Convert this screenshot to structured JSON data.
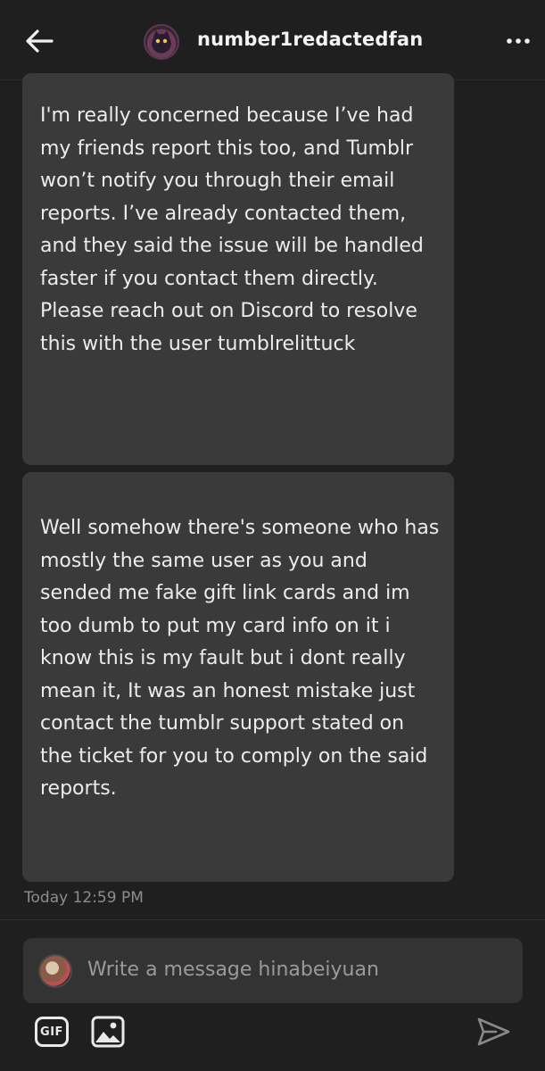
{
  "header": {
    "username": "number1redactedfan",
    "back_icon": "arrow-left-icon",
    "more_icon": "more-horizontal-icon"
  },
  "messages": [
    {
      "text": "I'm really concerned because I’ve had my friends report this too, and Tumblr won’t notify you through their email reports. I’ve already contacted them, and they said the issue will be handled faster if you contact them directly. Please reach out on Discord to resolve this with the user tumblrelittuck"
    },
    {
      "text": "Well somehow there's someone who has mostly the same user as you and sended me fake gift link cards and im too dumb to put my card info on it i know this is my fault but i dont really mean it, It was an honest mistake just contact the tumblr support stated on the ticket for you to comply on the said reports."
    }
  ],
  "timestamp": "Today 12:59 PM",
  "composer": {
    "placeholder": "Write a message hinabeiyuan"
  },
  "toolbar": {
    "gif_label": "GIF",
    "image_icon": "image-icon",
    "send_icon": "send-icon"
  },
  "colors": {
    "background": "#1f1f1f",
    "bubble": "#3a3a3a",
    "composer": "#333333",
    "timestamp": "#8d8d8d"
  }
}
